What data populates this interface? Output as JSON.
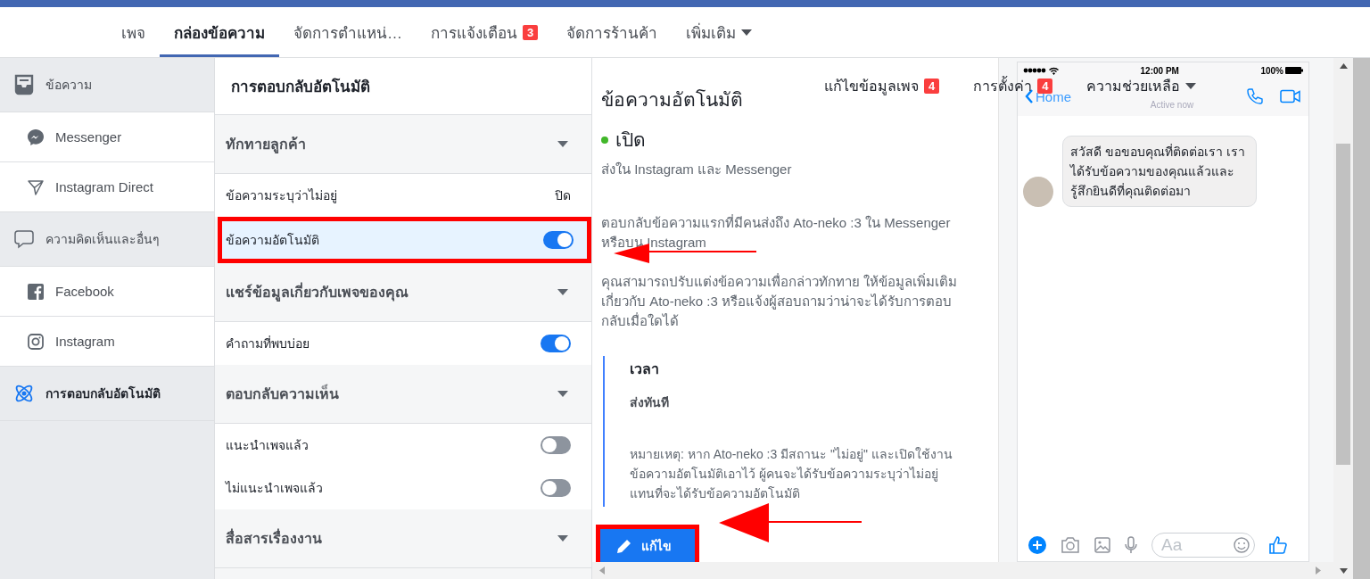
{
  "nav": {
    "tabs": [
      {
        "label": "เพจ",
        "selected": false
      },
      {
        "label": "กล่องข้อความ",
        "selected": true
      },
      {
        "label": "จัดการตำแหน่…",
        "selected": false
      },
      {
        "label": "การแจ้งเตือน",
        "selected": false,
        "badge": "3"
      },
      {
        "label": "จัดการร้านค้า",
        "selected": false
      },
      {
        "label": "เพิ่มเติม",
        "selected": false,
        "dropdown": true
      }
    ]
  },
  "overlay_nav": [
    {
      "label": "แก้ไขข้อมูลเพจ",
      "badge": "4"
    },
    {
      "label": "การตั้งค่า",
      "badge": "4"
    },
    {
      "label": "ความช่วยเหลือ",
      "dropdown": true
    }
  ],
  "sidebar": {
    "items": [
      {
        "kind": "section",
        "label": "ข้อความ",
        "selected": false
      },
      {
        "kind": "sub",
        "label": "Messenger",
        "selected": false
      },
      {
        "kind": "sub",
        "label": "Instagram Direct",
        "selected": false
      },
      {
        "kind": "section",
        "label": "ความคิดเห็นและอื่นๆ",
        "selected": false
      },
      {
        "kind": "sub",
        "label": "Facebook",
        "selected": false
      },
      {
        "kind": "sub",
        "label": "Instagram",
        "selected": false
      },
      {
        "kind": "section",
        "label": "การตอบกลับอัตโนมัติ",
        "selected": true
      }
    ]
  },
  "settings": {
    "title": "การตอบกลับอัตโนมัติ",
    "rows": [
      {
        "kind": "group",
        "label": "ทักทายลูกค้า"
      },
      {
        "kind": "status",
        "label": "ข้อความระบุว่าไม่อยู่",
        "value": "ปิด",
        "selected": false
      },
      {
        "kind": "toggle",
        "label": "ข้อความอัตโนมัติ",
        "on": true,
        "selected": true,
        "highlighted": true
      },
      {
        "kind": "group",
        "label": "แชร์ข้อมูลเกี่ยวกับเพจของคุณ"
      },
      {
        "kind": "toggle",
        "label": "คำถามที่พบบ่อย",
        "on": true,
        "selected": false
      },
      {
        "kind": "group",
        "label": "ตอบกลับความเห็น"
      },
      {
        "kind": "toggle",
        "label": "แนะนำเพจแล้ว",
        "on": false,
        "selected": false
      },
      {
        "kind": "toggle",
        "label": "ไม่แนะนำเพจแล้ว",
        "on": false,
        "selected": false
      },
      {
        "kind": "group",
        "label": "สื่อสารเรื่องงาน"
      }
    ]
  },
  "detail": {
    "title": "ข้อความอัตโนมัติ",
    "status": {
      "label": "เปิด",
      "color": "#42b72a"
    },
    "subtitle": "ส่งใน Instagram และ Messenger",
    "paragraphs": [
      "ตอบกลับข้อความแรกที่มีคนส่งถึง Ato-neko :3 ใน Messenger หรือบน Instagram",
      "คุณสามารถปรับแต่งข้อความเพื่อกล่าวทักทาย ให้ข้อมูลเพิ่มเติมเกี่ยวกับ Ato-neko :3 หรือแจ้งผู้สอบถามว่าน่าจะได้รับการตอบกลับเมื่อใดได้"
    ],
    "timing": {
      "label": "เวลา",
      "value": "ส่งทันที",
      "note": "หมายเหตุ: หาก Ato-neko :3 มีสถานะ \"ไม่อยู่\" และเปิดใช้งานข้อความอัตโนมัติเอาไว้ ผู้คนจะได้รับข้อความระบุว่าไม่อยู่แทนที่จะได้รับข้อความอัตโนมัติ"
    },
    "edit_button": {
      "label": "แก้ไข",
      "highlighted": true
    }
  },
  "phone": {
    "time": "12:00 PM",
    "battery": "100%",
    "back": "Home",
    "presence": "Active now",
    "message": "สวัสดี ขอขอบคุณที่ติดต่อเรา เราได้รับข้อความของคุณแล้วและรู้สึกยินดีที่คุณติดต่อมา",
    "composer": {
      "placeholder": "Aa"
    }
  }
}
